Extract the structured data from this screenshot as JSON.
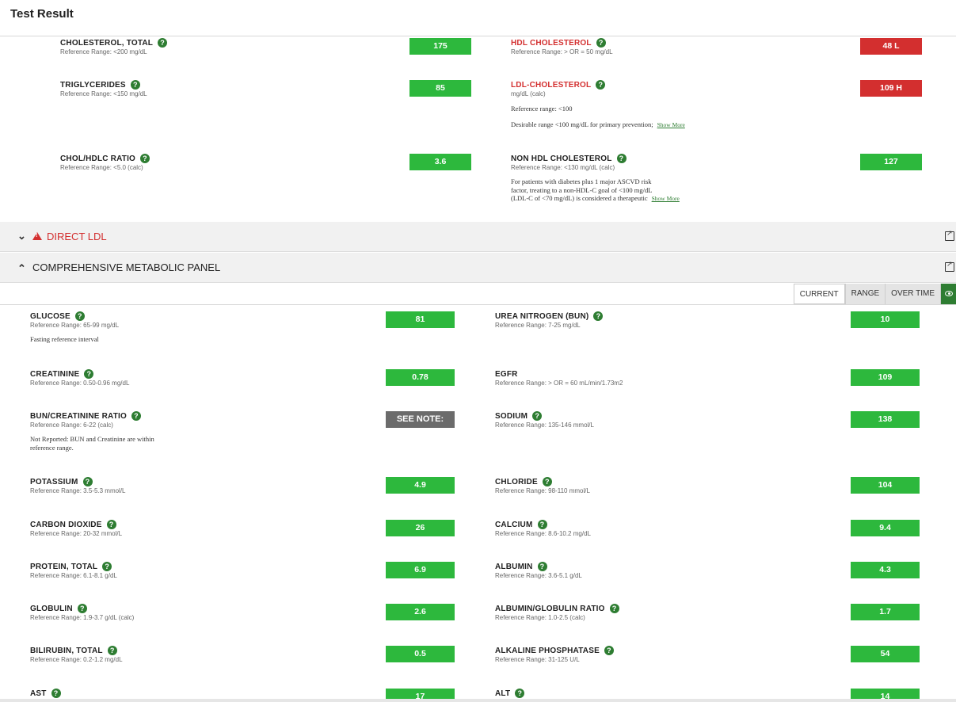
{
  "page_title": "Test Result",
  "lipid": {
    "chol_total": {
      "name": "CHOLESTEROL, TOTAL",
      "ref": "Reference Range: <200 mg/dL",
      "value": "175"
    },
    "hdl": {
      "name": "HDL CHOLESTEROL",
      "ref": "Reference Range: > OR = 50 mg/dL",
      "value": "48 L"
    },
    "trig": {
      "name": "TRIGLYCERIDES",
      "ref": "Reference Range: <150 mg/dL",
      "value": "85"
    },
    "ldl": {
      "name": "LDL-CHOLESTEROL",
      "ref": "mg/dL (calc)",
      "note1": "Reference range: <100",
      "note2": "Desirable range <100 mg/dL for primary prevention;",
      "show_more": "Show More",
      "value": "109 H"
    },
    "ratio": {
      "name": "CHOL/HDLC RATIO",
      "ref": "Reference Range: <5.0 (calc)",
      "value": "3.6"
    },
    "nonhdl": {
      "name": "NON HDL CHOLESTEROL",
      "ref": "Reference Range: <130 mg/dL (calc)",
      "note1": "For patients with diabetes plus 1 major ASCVD risk",
      "note2": "factor, treating to a non-HDL-C goal of <100 mg/dL",
      "note3": "(LDL-C of <70 mg/dL) is considered a therapeutic",
      "show_more": "Show More",
      "value": "127"
    }
  },
  "sections": {
    "direct_ldl": "DIRECT LDL",
    "cmp": "COMPREHENSIVE METABOLIC PANEL"
  },
  "tabs": {
    "current": "CURRENT",
    "range": "RANGE",
    "over_time": "OVER TIME"
  },
  "cmp": {
    "glucose": {
      "name": "GLUCOSE",
      "ref": "Reference Range: 65-99 mg/dL",
      "note": "Fasting reference interval",
      "value": "81"
    },
    "bun": {
      "name": "UREA NITROGEN (BUN)",
      "ref": "Reference Range: 7-25 mg/dL",
      "value": "10"
    },
    "creatinine": {
      "name": "CREATININE",
      "ref": "Reference Range: 0.50-0.96 mg/dL",
      "value": "0.78"
    },
    "egfr": {
      "name": "EGFR",
      "ref": "Reference Range: > OR = 60 mL/min/1.73m2",
      "value": "109"
    },
    "buncr": {
      "name": "BUN/CREATININE RATIO",
      "ref": "Reference Range: 6-22 (calc)",
      "note1": "Not Reported: BUN and Creatinine are within",
      "note2": "reference range.",
      "value": "SEE NOTE:"
    },
    "sodium": {
      "name": "SODIUM",
      "ref": "Reference Range: 135-146 mmol/L",
      "value": "138"
    },
    "potassium": {
      "name": "POTASSIUM",
      "ref": "Reference Range: 3.5-5.3 mmol/L",
      "value": "4.9"
    },
    "chloride": {
      "name": "CHLORIDE",
      "ref": "Reference Range: 98-110 mmol/L",
      "value": "104"
    },
    "co2": {
      "name": "CARBON DIOXIDE",
      "ref": "Reference Range: 20-32 mmol/L",
      "value": "26"
    },
    "calcium": {
      "name": "CALCIUM",
      "ref": "Reference Range: 8.6-10.2 mg/dL",
      "value": "9.4"
    },
    "protein": {
      "name": "PROTEIN, TOTAL",
      "ref": "Reference Range: 6.1-8.1 g/dL",
      "value": "6.9"
    },
    "albumin": {
      "name": "ALBUMIN",
      "ref": "Reference Range: 3.6-5.1 g/dL",
      "value": "4.3"
    },
    "globulin": {
      "name": "GLOBULIN",
      "ref": "Reference Range: 1.9-3.7 g/dL (calc)",
      "value": "2.6"
    },
    "agratio": {
      "name": "ALBUMIN/GLOBULIN RATIO",
      "ref": "Reference Range: 1.0-2.5 (calc)",
      "value": "1.7"
    },
    "bili": {
      "name": "BILIRUBIN, TOTAL",
      "ref": "Reference Range: 0.2-1.2 mg/dL",
      "value": "0.5"
    },
    "alkphos": {
      "name": "ALKALINE PHOSPHATASE",
      "ref": "Reference Range: 31-125 U/L",
      "value": "54"
    },
    "ast": {
      "name": "AST",
      "value": "17"
    },
    "alt": {
      "name": "ALT",
      "value": "14"
    }
  },
  "icons": {
    "help": "question-circle-icon",
    "warning": "warning-triangle-icon",
    "external": "external-link-icon",
    "eye": "eye-icon"
  },
  "colors": {
    "normal": "#2db83d",
    "abnormal": "#d32f2f",
    "note_badge": "#6b6b6b",
    "brand_green": "#2e7d32"
  }
}
